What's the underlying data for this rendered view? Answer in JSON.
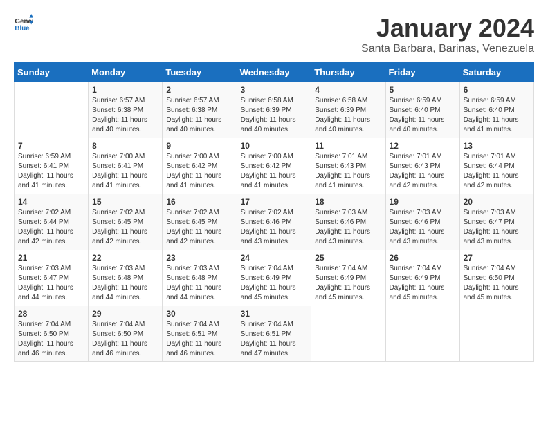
{
  "header": {
    "logo_general": "General",
    "logo_blue": "Blue",
    "title": "January 2024",
    "subtitle": "Santa Barbara, Barinas, Venezuela"
  },
  "days_of_week": [
    "Sunday",
    "Monday",
    "Tuesday",
    "Wednesday",
    "Thursday",
    "Friday",
    "Saturday"
  ],
  "weeks": [
    [
      {
        "day": "",
        "info": ""
      },
      {
        "day": "1",
        "info": "Sunrise: 6:57 AM\nSunset: 6:38 PM\nDaylight: 11 hours\nand 40 minutes."
      },
      {
        "day": "2",
        "info": "Sunrise: 6:57 AM\nSunset: 6:38 PM\nDaylight: 11 hours\nand 40 minutes."
      },
      {
        "day": "3",
        "info": "Sunrise: 6:58 AM\nSunset: 6:39 PM\nDaylight: 11 hours\nand 40 minutes."
      },
      {
        "day": "4",
        "info": "Sunrise: 6:58 AM\nSunset: 6:39 PM\nDaylight: 11 hours\nand 40 minutes."
      },
      {
        "day": "5",
        "info": "Sunrise: 6:59 AM\nSunset: 6:40 PM\nDaylight: 11 hours\nand 40 minutes."
      },
      {
        "day": "6",
        "info": "Sunrise: 6:59 AM\nSunset: 6:40 PM\nDaylight: 11 hours\nand 41 minutes."
      }
    ],
    [
      {
        "day": "7",
        "info": "Sunrise: 6:59 AM\nSunset: 6:41 PM\nDaylight: 11 hours\nand 41 minutes."
      },
      {
        "day": "8",
        "info": "Sunrise: 7:00 AM\nSunset: 6:41 PM\nDaylight: 11 hours\nand 41 minutes."
      },
      {
        "day": "9",
        "info": "Sunrise: 7:00 AM\nSunset: 6:42 PM\nDaylight: 11 hours\nand 41 minutes."
      },
      {
        "day": "10",
        "info": "Sunrise: 7:00 AM\nSunset: 6:42 PM\nDaylight: 11 hours\nand 41 minutes."
      },
      {
        "day": "11",
        "info": "Sunrise: 7:01 AM\nSunset: 6:43 PM\nDaylight: 11 hours\nand 41 minutes."
      },
      {
        "day": "12",
        "info": "Sunrise: 7:01 AM\nSunset: 6:43 PM\nDaylight: 11 hours\nand 42 minutes."
      },
      {
        "day": "13",
        "info": "Sunrise: 7:01 AM\nSunset: 6:44 PM\nDaylight: 11 hours\nand 42 minutes."
      }
    ],
    [
      {
        "day": "14",
        "info": "Sunrise: 7:02 AM\nSunset: 6:44 PM\nDaylight: 11 hours\nand 42 minutes."
      },
      {
        "day": "15",
        "info": "Sunrise: 7:02 AM\nSunset: 6:45 PM\nDaylight: 11 hours\nand 42 minutes."
      },
      {
        "day": "16",
        "info": "Sunrise: 7:02 AM\nSunset: 6:45 PM\nDaylight: 11 hours\nand 42 minutes."
      },
      {
        "day": "17",
        "info": "Sunrise: 7:02 AM\nSunset: 6:46 PM\nDaylight: 11 hours\nand 43 minutes."
      },
      {
        "day": "18",
        "info": "Sunrise: 7:03 AM\nSunset: 6:46 PM\nDaylight: 11 hours\nand 43 minutes."
      },
      {
        "day": "19",
        "info": "Sunrise: 7:03 AM\nSunset: 6:46 PM\nDaylight: 11 hours\nand 43 minutes."
      },
      {
        "day": "20",
        "info": "Sunrise: 7:03 AM\nSunset: 6:47 PM\nDaylight: 11 hours\nand 43 minutes."
      }
    ],
    [
      {
        "day": "21",
        "info": "Sunrise: 7:03 AM\nSunset: 6:47 PM\nDaylight: 11 hours\nand 44 minutes."
      },
      {
        "day": "22",
        "info": "Sunrise: 7:03 AM\nSunset: 6:48 PM\nDaylight: 11 hours\nand 44 minutes."
      },
      {
        "day": "23",
        "info": "Sunrise: 7:03 AM\nSunset: 6:48 PM\nDaylight: 11 hours\nand 44 minutes."
      },
      {
        "day": "24",
        "info": "Sunrise: 7:04 AM\nSunset: 6:49 PM\nDaylight: 11 hours\nand 45 minutes."
      },
      {
        "day": "25",
        "info": "Sunrise: 7:04 AM\nSunset: 6:49 PM\nDaylight: 11 hours\nand 45 minutes."
      },
      {
        "day": "26",
        "info": "Sunrise: 7:04 AM\nSunset: 6:49 PM\nDaylight: 11 hours\nand 45 minutes."
      },
      {
        "day": "27",
        "info": "Sunrise: 7:04 AM\nSunset: 6:50 PM\nDaylight: 11 hours\nand 45 minutes."
      }
    ],
    [
      {
        "day": "28",
        "info": "Sunrise: 7:04 AM\nSunset: 6:50 PM\nDaylight: 11 hours\nand 46 minutes."
      },
      {
        "day": "29",
        "info": "Sunrise: 7:04 AM\nSunset: 6:50 PM\nDaylight: 11 hours\nand 46 minutes."
      },
      {
        "day": "30",
        "info": "Sunrise: 7:04 AM\nSunset: 6:51 PM\nDaylight: 11 hours\nand 46 minutes."
      },
      {
        "day": "31",
        "info": "Sunrise: 7:04 AM\nSunset: 6:51 PM\nDaylight: 11 hours\nand 47 minutes."
      },
      {
        "day": "",
        "info": ""
      },
      {
        "day": "",
        "info": ""
      },
      {
        "day": "",
        "info": ""
      }
    ]
  ]
}
